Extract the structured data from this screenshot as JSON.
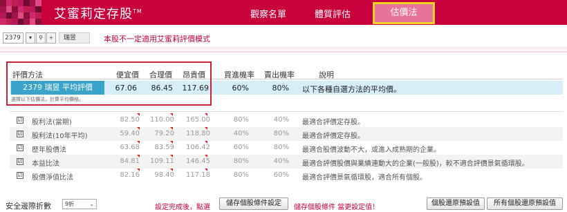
{
  "header": {
    "brand": "艾蜜莉定存股",
    "trademark": "TM",
    "nav": [
      "觀察名單",
      "體質評估",
      "估價法"
    ],
    "active_nav": "估價法",
    "colors": {
      "brand": "#c8003c",
      "active_tab": "#e8729a",
      "highlight": "#f5d327"
    }
  },
  "toolbar": {
    "stock_code": "2379",
    "dropdown_icon": "chevron-down-icon",
    "search_icon": "search-icon",
    "add_icon": "plus-icon",
    "stock_name": "瑞昱",
    "notice": "本股不一定適用艾蜜莉評價模式"
  },
  "table": {
    "headers": [
      "評價方法",
      "便宜價",
      "合理價",
      "昂貴價",
      "買進機率",
      "賣出機率",
      "說明"
    ],
    "summary": {
      "label": "2379 瑞昱 平均評價",
      "cheap": "67.06",
      "fair": "86.45",
      "expensive": "117.69",
      "buy_prob": "60%",
      "sell_prob": "80%",
      "desc": "以下各種自選方法的平均價。",
      "note": "選擇以下估價法，計算平均價格。"
    },
    "rows": [
      {
        "checked": "☑",
        "method": "股利法(當期)",
        "cheap": "82.50",
        "fair": "110.00",
        "expensive": "165.00",
        "buy": "80%",
        "sell": "40%",
        "desc": "最適合評價定存股。"
      },
      {
        "checked": "☑",
        "method": "股利法(10年平均)",
        "cheap": "59.40",
        "fair": "79.20",
        "expensive": "118.80",
        "buy": "40%",
        "sell": "80%",
        "desc": "最適合評價定存股。"
      },
      {
        "checked": "☑",
        "method": "歷年股價法",
        "cheap": "63.68",
        "fair": "83.59",
        "expensive": "106.42",
        "buy": "60%",
        "sell": "80%",
        "desc": "最適合股價波動不大，或進入成熟期的企業。"
      },
      {
        "checked": "☑",
        "method": "本益比法",
        "cheap": "84.81",
        "fair": "109.11",
        "expensive": "146.45",
        "buy": "80%",
        "sell": "40%",
        "desc": "最適合評價股價與業績連動大的企業(一般股)，較不適合評價景氣循環股。"
      },
      {
        "checked": "☑",
        "method": "股價淨值比法",
        "cheap": "82.16",
        "fair": "98.40",
        "expensive": "117.18",
        "buy": "80%",
        "sell": "60%",
        "desc": "最適合評價景氣循環股，適合所有個股。"
      }
    ]
  },
  "bottom": {
    "discount_label": "安全邊際折數",
    "discount_value": "9折",
    "hint1": "設定完成後，點選",
    "save_button": "儲存個股條件設定",
    "hint2": "儲存個股條件 當更設定值！",
    "reset_one": "個股還原預設值",
    "reset_all": "所有個股還原預設值"
  }
}
